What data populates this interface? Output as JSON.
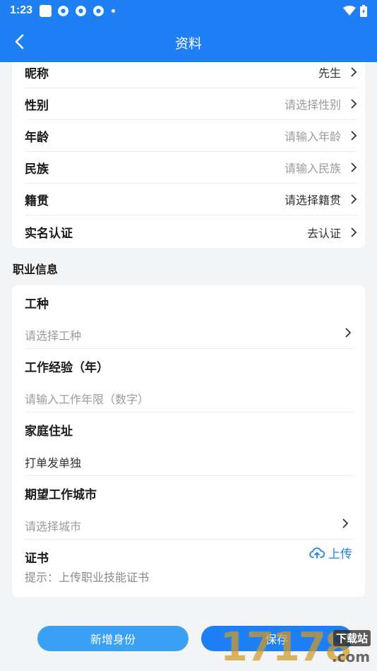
{
  "status_bar": {
    "time": "1:23"
  },
  "header": {
    "title": "资料"
  },
  "personal": {
    "rows": [
      {
        "label": "昵称",
        "value": "先生"
      },
      {
        "label": "性别",
        "value": "请选择性别"
      },
      {
        "label": "年龄",
        "value": "请输入年龄"
      },
      {
        "label": "民族",
        "value": "请输入民族"
      },
      {
        "label": "籍贯",
        "value": "请选择籍贯"
      },
      {
        "label": "实名认证",
        "value": "去认证"
      }
    ]
  },
  "career": {
    "section_title": "职业信息",
    "job_type": {
      "label": "工种",
      "placeholder": "请选择工种"
    },
    "experience": {
      "label": "工作经验（年）",
      "placeholder": "请输入工作年限（数字）"
    },
    "address": {
      "label": "家庭住址",
      "value": "打单发单独"
    },
    "city": {
      "label": "期望工作城市",
      "placeholder": "请选择城市"
    },
    "certificate": {
      "label": "证书",
      "upload_label": "上传",
      "hint": "提示：上传职业技能证书"
    }
  },
  "actions": {
    "add_identity": "新增身份",
    "save": "保存"
  },
  "watermark": {
    "number": "17178",
    "tag": "下载站",
    "domain": ".com"
  }
}
